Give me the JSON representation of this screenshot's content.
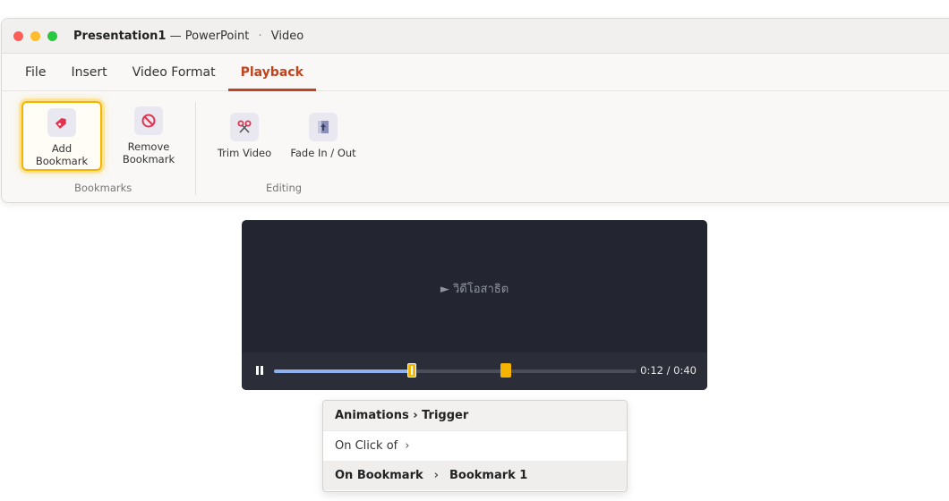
{
  "window": {
    "doc_title": "Presentation1",
    "app_name": "— PowerPoint",
    "separator": "·",
    "context": "Video",
    "traffic_lights": [
      "#ff5f57",
      "#febc2e",
      "#28c840"
    ]
  },
  "tabs": [
    {
      "label": "File",
      "active": false
    },
    {
      "label": "Insert",
      "active": false
    },
    {
      "label": "Video Format",
      "active": false
    },
    {
      "label": "Playback",
      "active": true
    }
  ],
  "ribbon": {
    "bookmarks_group": "Bookmarks",
    "editing_group": "Editing",
    "add_bookmark": "Add\nBookmark",
    "remove_bookmark": "Remove\nBookmark",
    "trim_video": "Trim Video",
    "fade": "Fade In / Out",
    "icons": {
      "add_bookmark": "bookmark-add-icon",
      "remove_bookmark": "no-symbol-icon",
      "trim_video": "scissors-icon",
      "fade": "fade-icon"
    },
    "accent": "#c0441f",
    "highlight_color": "#f4b400"
  },
  "player": {
    "label": "► วิดีโอสาธิต",
    "time": "0:12 / 0:40",
    "progress_fraction": 0.38,
    "bookmarks_fraction": [
      0.38,
      0.64
    ]
  },
  "menu": {
    "header": "Animations › Trigger",
    "items": [
      {
        "label": "On Click of",
        "chevron": "›"
      },
      {
        "label": "On Bookmark",
        "chevron": "›",
        "value": "Bookmark 1"
      }
    ]
  }
}
